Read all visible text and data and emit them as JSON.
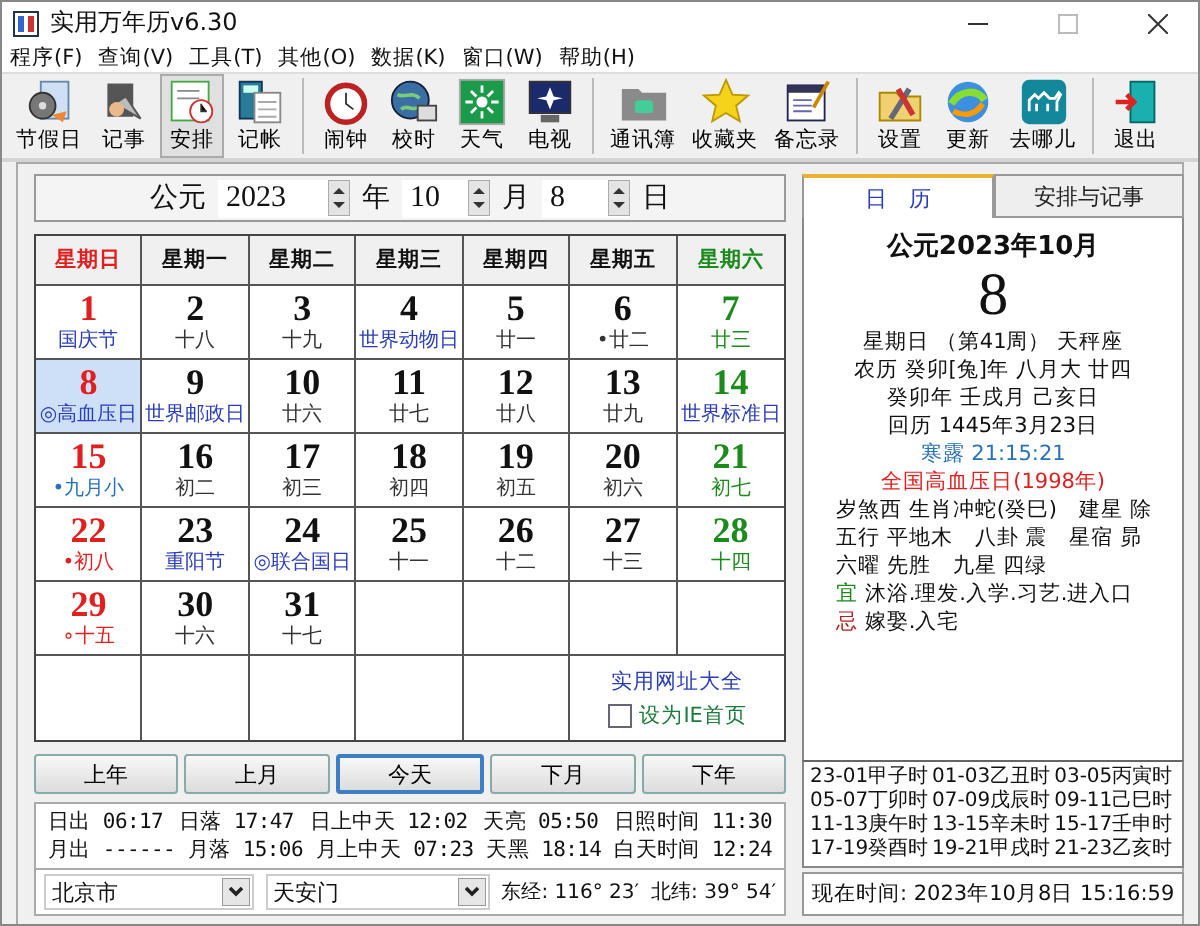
{
  "window": {
    "title": "实用万年历v6.30"
  },
  "menu": [
    "程序(F)",
    "查询(V)",
    "工具(T)",
    "其他(O)",
    "数据(K)",
    "窗口(W)",
    "帮助(H)"
  ],
  "toolbar": [
    {
      "items": [
        {
          "label": "节假日",
          "pressed": false
        },
        {
          "label": "记事",
          "pressed": false
        },
        {
          "label": "安排",
          "pressed": true
        },
        {
          "label": "记帐",
          "pressed": false
        }
      ]
    },
    {
      "items": [
        {
          "label": "闹钟",
          "pressed": false
        },
        {
          "label": "校时",
          "pressed": false
        },
        {
          "label": "天气",
          "pressed": false
        },
        {
          "label": "电视",
          "pressed": false
        }
      ]
    },
    {
      "items": [
        {
          "label": "通讯簿",
          "pressed": false
        },
        {
          "label": "收藏夹",
          "pressed": false
        },
        {
          "label": "备忘录",
          "pressed": false
        }
      ]
    },
    {
      "items": [
        {
          "label": "设置",
          "pressed": false
        },
        {
          "label": "更新",
          "pressed": false
        },
        {
          "label": "去哪儿",
          "pressed": false
        }
      ]
    },
    {
      "items": [
        {
          "label": "退出",
          "pressed": false
        }
      ]
    }
  ],
  "date_picker": {
    "era": "公元",
    "year": "2023",
    "year_unit": "年",
    "month": "10",
    "month_unit": "月",
    "day": "8",
    "day_unit": "日"
  },
  "weekdays": [
    "星期日",
    "星期一",
    "星期二",
    "星期三",
    "星期四",
    "星期五",
    "星期六"
  ],
  "weeks": [
    [
      {
        "day": "1",
        "note": "国庆节",
        "kind": "festival",
        "selected": false
      },
      {
        "day": "2",
        "note": "十八",
        "kind": "lunar",
        "selected": false
      },
      {
        "day": "3",
        "note": "十九",
        "kind": "lunar",
        "selected": false
      },
      {
        "day": "4",
        "note": "世界动物日",
        "kind": "festival",
        "selected": false
      },
      {
        "day": "5",
        "note": "廿一",
        "kind": "lunar",
        "selected": false
      },
      {
        "day": "6",
        "note": "•廿二",
        "kind": "lunar",
        "selected": false
      },
      {
        "day": "7",
        "note": "廿三",
        "kind": "lunar",
        "selected": false
      }
    ],
    [
      {
        "day": "8",
        "note": "◎高血压日",
        "kind": "festival",
        "selected": true
      },
      {
        "day": "9",
        "note": "世界邮政日",
        "kind": "festival",
        "selected": false
      },
      {
        "day": "10",
        "note": "廿六",
        "kind": "lunar",
        "selected": false
      },
      {
        "day": "11",
        "note": "廿七",
        "kind": "lunar",
        "selected": false
      },
      {
        "day": "12",
        "note": "廿八",
        "kind": "lunar",
        "selected": false
      },
      {
        "day": "13",
        "note": "廿九",
        "kind": "lunar",
        "selected": false
      },
      {
        "day": "14",
        "note": "世界标准日",
        "kind": "festival",
        "selected": false
      }
    ],
    [
      {
        "day": "15",
        "note": "•九月小",
        "kind": "month",
        "selected": false
      },
      {
        "day": "16",
        "note": "初二",
        "kind": "lunar",
        "selected": false
      },
      {
        "day": "17",
        "note": "初三",
        "kind": "lunar",
        "selected": false
      },
      {
        "day": "18",
        "note": "初四",
        "kind": "lunar",
        "selected": false
      },
      {
        "day": "19",
        "note": "初五",
        "kind": "lunar",
        "selected": false
      },
      {
        "day": "20",
        "note": "初六",
        "kind": "lunar",
        "selected": false
      },
      {
        "day": "21",
        "note": "初七",
        "kind": "lunar",
        "selected": false
      }
    ],
    [
      {
        "day": "22",
        "note": "•初八",
        "kind": "lunar",
        "selected": false
      },
      {
        "day": "23",
        "note": "重阳节",
        "kind": "festival",
        "selected": false
      },
      {
        "day": "24",
        "note": "◎联合国日",
        "kind": "festival",
        "selected": false
      },
      {
        "day": "25",
        "note": "十一",
        "kind": "lunar",
        "selected": false
      },
      {
        "day": "26",
        "note": "十二",
        "kind": "lunar",
        "selected": false
      },
      {
        "day": "27",
        "note": "十三",
        "kind": "lunar",
        "selected": false
      },
      {
        "day": "28",
        "note": "十四",
        "kind": "lunar",
        "selected": false
      }
    ],
    [
      {
        "day": "29",
        "note": "∘十五",
        "kind": "lunar",
        "selected": false
      },
      {
        "day": "30",
        "note": "十六",
        "kind": "lunar",
        "selected": false
      },
      {
        "day": "31",
        "note": "十七",
        "kind": "lunar",
        "selected": false
      }
    ]
  ],
  "links": {
    "sites": "实用网址大全",
    "homepage": {
      "label": "设为IE首页",
      "checked": false
    }
  },
  "nav_buttons": [
    {
      "label": "上年",
      "default": false
    },
    {
      "label": "上月",
      "default": false
    },
    {
      "label": "今天",
      "default": true
    },
    {
      "label": "下月",
      "default": false
    },
    {
      "label": "下年",
      "default": false
    }
  ],
  "sun_moon": [
    [
      {
        "label": "日出",
        "value": "06:17"
      },
      {
        "label": "日落",
        "value": "17:47"
      },
      {
        "label": "日上中天",
        "value": "12:02"
      },
      {
        "label": "天亮",
        "value": "05:50"
      },
      {
        "label": "日照时间",
        "value": "11:30"
      }
    ],
    [
      {
        "label": "月出",
        "value": "------"
      },
      {
        "label": "月落",
        "value": "15:06"
      },
      {
        "label": "月上中天",
        "value": "07:23"
      },
      {
        "label": "天黑",
        "value": "18:14"
      },
      {
        "label": "白天时间",
        "value": "12:24"
      }
    ]
  ],
  "location": {
    "city": "北京市",
    "place": "天安门",
    "longitude": "东经: 116° 23′",
    "latitude": "北纬: 39° 54′"
  },
  "side_tabs": [
    {
      "label": "日　历",
      "selected": true
    },
    {
      "label": "安排与记事",
      "selected": false
    }
  ],
  "details": [
    {
      "kind": "heading",
      "text": "公元2023年10月"
    },
    {
      "kind": "big",
      "text": "8"
    },
    {
      "kind": "line",
      "text": "星期日 （第41周） 天秤座"
    },
    {
      "kind": "line",
      "text": "农历 癸卯[兔]年 八月大 廿四"
    },
    {
      "kind": "line",
      "text": "癸卯年 壬戌月 己亥日"
    },
    {
      "kind": "line",
      "text": "回历 1445年3月23日"
    },
    {
      "kind": "term",
      "label": "寒露",
      "text": "21:15:21"
    },
    {
      "kind": "festival",
      "text": "全国高血压日(1998年)"
    },
    {
      "kind": "left",
      "text": "岁煞西 生肖冲蛇(癸巳)　建星 除"
    },
    {
      "kind": "left",
      "text": "五行 平地木　八卦 震　星宿 昴"
    },
    {
      "kind": "left",
      "text": "六曜 先胜　九星 四绿"
    },
    {
      "kind": "yi",
      "label": "宜",
      "text": "沐浴.理发.入学.习艺.进入口"
    },
    {
      "kind": "ji",
      "label": "忌",
      "text": "嫁娶.入宅"
    }
  ],
  "hours": [
    "23-01甲子时",
    "01-03乙丑时",
    "03-05丙寅时",
    "05-07丁卯时",
    "07-09戊辰时",
    "09-11己巳时",
    "11-13庚午时",
    "13-15辛未时",
    "15-17壬申时",
    "17-19癸酉时",
    "19-21甲戌时",
    "21-23乙亥时"
  ],
  "now": "现在时间: 2023年10月8日 15:16:59"
}
